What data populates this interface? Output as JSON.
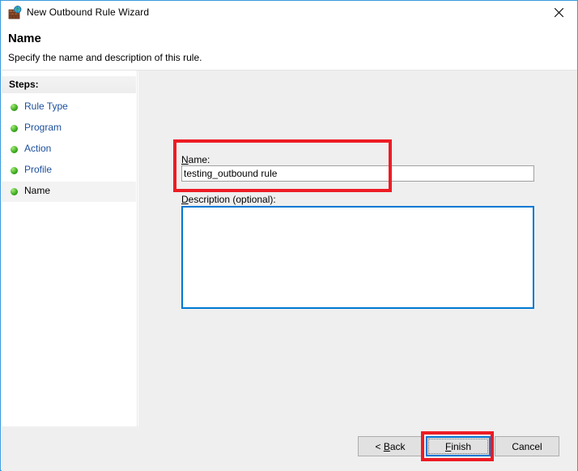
{
  "window": {
    "title": "New Outbound Rule Wizard",
    "icon": "firewall-globe-icon",
    "close_label": "✕",
    "border_color": "#3A9BDC"
  },
  "header": {
    "title": "Name",
    "subtitle": "Specify the name and description of this rule."
  },
  "sidebar": {
    "header": "Steps:",
    "items": [
      {
        "label": "Rule Type",
        "current": false
      },
      {
        "label": "Program",
        "current": false
      },
      {
        "label": "Action",
        "current": false
      },
      {
        "label": "Profile",
        "current": false
      },
      {
        "label": "Name",
        "current": true
      }
    ],
    "link_color": "#1B4F9C",
    "bullet_color": "#57C035"
  },
  "form": {
    "name_label_prefix": "",
    "name_label_accel": "N",
    "name_label_rest": "ame:",
    "name_value": "testing_outbound rule",
    "name_placeholder": "",
    "description_label_accel": "D",
    "description_label_rest": "escription (optional):",
    "description_value": "",
    "description_placeholder": ""
  },
  "buttons": {
    "back": {
      "prefix": "< ",
      "accel": "B",
      "rest": "ack"
    },
    "finish": {
      "prefix": "",
      "accel": "F",
      "rest": "inish",
      "focused": true
    },
    "cancel": {
      "prefix": "",
      "accel": "",
      "rest": "Cancel"
    }
  },
  "annotations": {
    "color": "#ED1C24",
    "boxes": [
      {
        "target": "name-field-group"
      },
      {
        "target": "finish-button"
      }
    ]
  }
}
